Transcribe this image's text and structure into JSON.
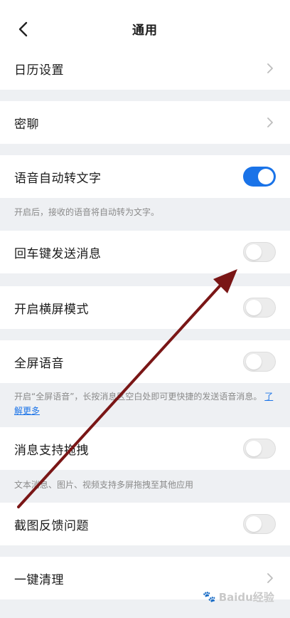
{
  "header": {
    "title": "通用",
    "back_icon": "chevron-left-icon"
  },
  "rows": {
    "calendar": {
      "label": "日历设置"
    },
    "secret_chat": {
      "label": "密聊"
    },
    "voice_to_text": {
      "label": "语音自动转文字",
      "enabled": true
    },
    "enter_send": {
      "label": "回车键发送消息",
      "enabled": false
    },
    "landscape": {
      "label": "开启横屏模式",
      "enabled": false
    },
    "fullscreen_voice": {
      "label": "全屏语音",
      "enabled": false
    },
    "drag_drop": {
      "label": "消息支持拖拽",
      "enabled": false
    },
    "screenshot_feedback": {
      "label": "截图反馈问题",
      "enabled": false
    },
    "one_click_clean": {
      "label": "一键清理"
    }
  },
  "notes": {
    "voice_to_text": "开启后，接收的语音将自动转为文字。",
    "fullscreen_voice": "开启“全屏语音”，长按消息区空白处即可更快捷的发送语音消息。",
    "fullscreen_voice_link": "了解更多",
    "drag_drop": "文本消息、图片、视频支持多屏拖拽至其他应用"
  },
  "watermark": {
    "text": "Baidu经验"
  },
  "colors": {
    "accent": "#1a73e8",
    "annotation_arrow": "#7a1616"
  }
}
